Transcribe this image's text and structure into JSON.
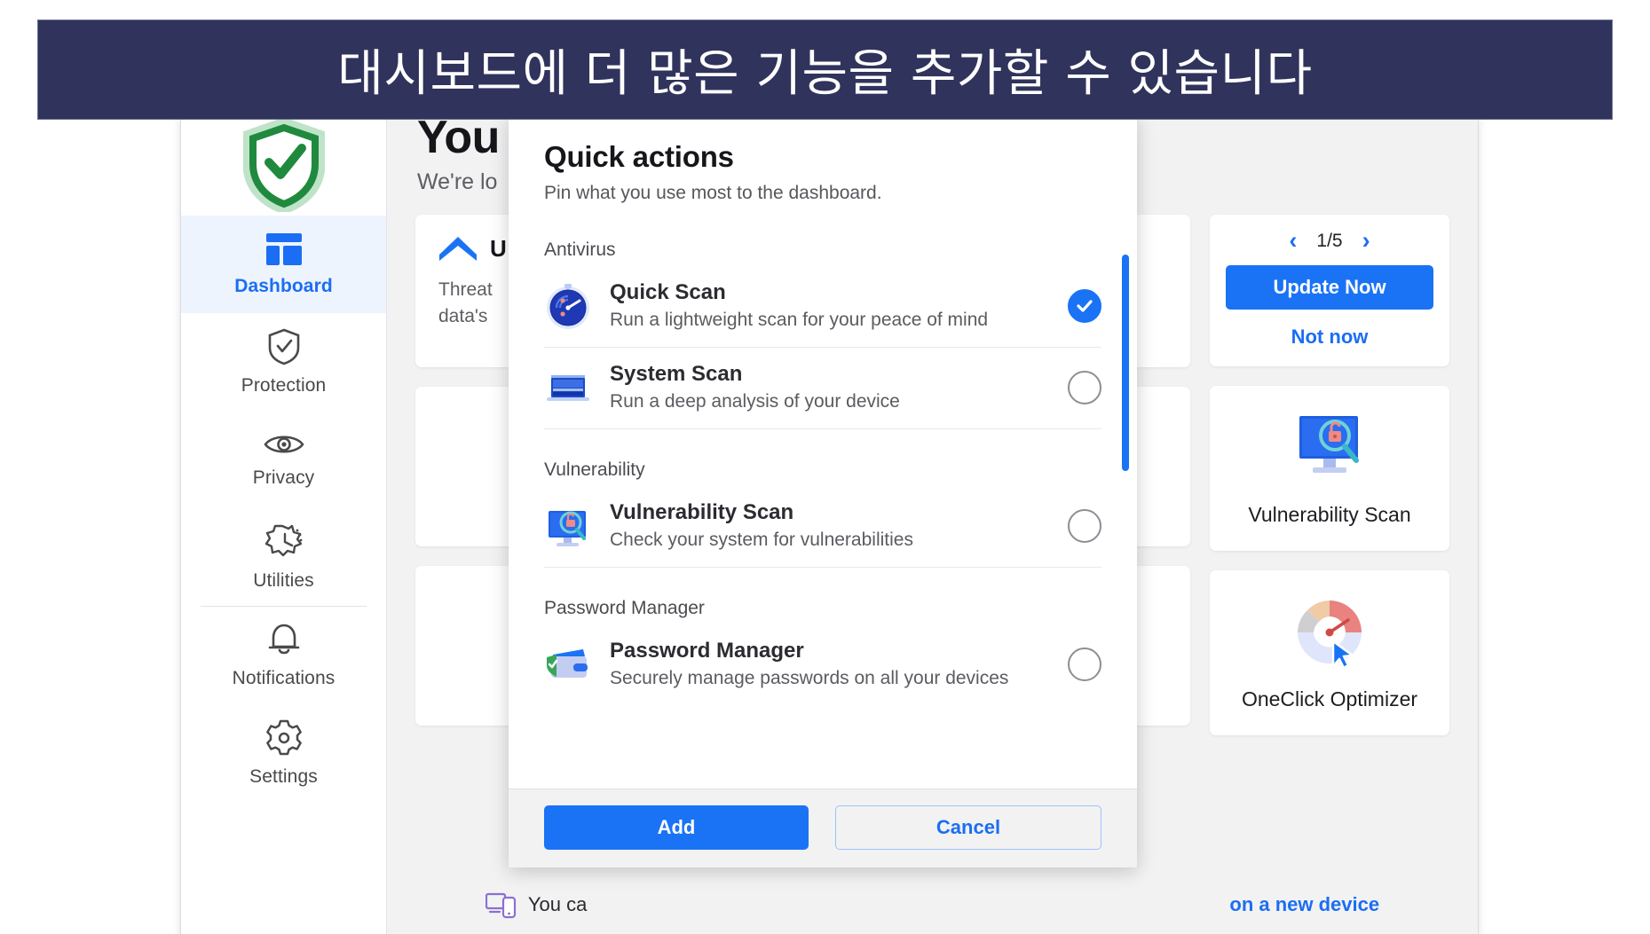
{
  "caption": {
    "text": "대시보드에 더 많은 기능을 추가할 수 있습니다"
  },
  "colors": {
    "accent_blue": "#1a73f5",
    "link_blue": "#1b6ef3",
    "banner_navy": "#30335c",
    "shield_green": "#1f8a3e",
    "app_bg": "#f2f2f3"
  },
  "sidebar": {
    "items": [
      {
        "label": "Dashboard",
        "icon": "dashboard-icon",
        "active": true
      },
      {
        "label": "Protection",
        "icon": "shield-check-icon",
        "active": false
      },
      {
        "label": "Privacy",
        "icon": "eye-icon",
        "active": false
      },
      {
        "label": "Utilities",
        "icon": "gear-cog-icon",
        "active": false
      },
      {
        "label": "Notifications",
        "icon": "bell-icon",
        "active": false
      },
      {
        "label": "Settings",
        "icon": "settings-gear-icon",
        "active": false
      }
    ]
  },
  "main": {
    "title": "You",
    "subtitle": "We're lo",
    "card_update": {
      "title": "U",
      "body_line1": "Threat",
      "body_line2": "data's"
    },
    "update_panel": {
      "page_indicator": "1/5",
      "prev_arrow": "‹",
      "next_arrow": "›",
      "primary_button": "Update Now",
      "secondary_link": "Not now"
    },
    "tiles": [
      {
        "label": "Vulnerability Scan",
        "icon": "monitor-lock-magnifier-icon"
      },
      {
        "label": "OneClick Optimizer",
        "icon": "gauge-cursor-icon"
      }
    ],
    "bottom_strip": {
      "icon": "devices-icon",
      "text_start": "You ca",
      "text_end": "on a new device"
    }
  },
  "modal": {
    "title": "Quick actions",
    "subtitle": "Pin what you use most to the dashboard.",
    "groups": [
      {
        "label": "Antivirus",
        "options": [
          {
            "name": "Quick Scan",
            "desc": "Run a lightweight scan for your peace of mind",
            "icon": "stopwatch-scan-icon",
            "checked": true
          },
          {
            "name": "System Scan",
            "desc": "Run a deep analysis of your device",
            "icon": "laptop-scan-icon",
            "checked": false
          }
        ]
      },
      {
        "label": "Vulnerability",
        "options": [
          {
            "name": "Vulnerability Scan",
            "desc": "Check your system for vulnerabilities",
            "icon": "monitor-lock-icon",
            "checked": false
          }
        ]
      },
      {
        "label": "Password Manager",
        "options": [
          {
            "name": "Password Manager",
            "desc": "Securely manage passwords on all your devices",
            "icon": "wallet-shield-icon",
            "checked": false
          }
        ]
      }
    ],
    "footer": {
      "add_label": "Add",
      "cancel_label": "Cancel"
    }
  }
}
